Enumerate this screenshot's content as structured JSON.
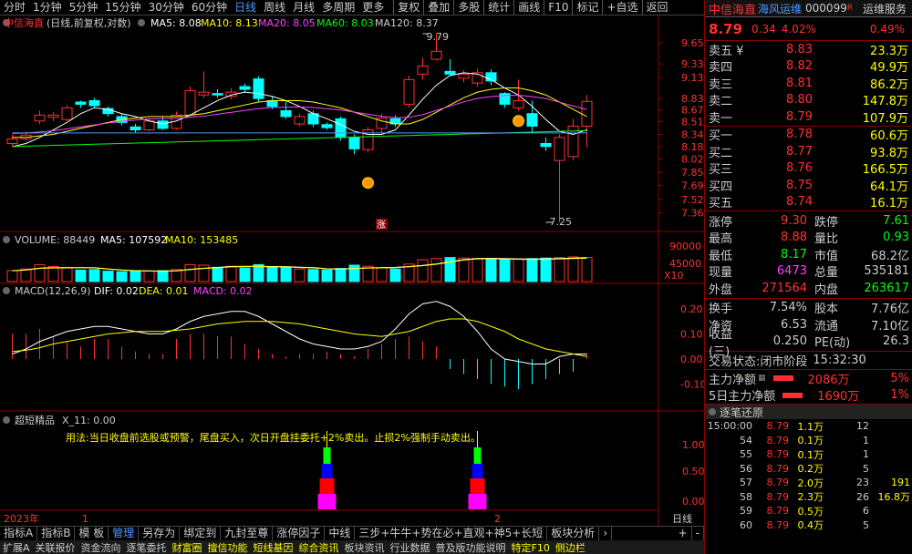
{
  "toolbar": {
    "periods": [
      "分时",
      "1分钟",
      "5分钟",
      "15分钟",
      "30分钟",
      "60分钟",
      "日线",
      "周线",
      "月线",
      "多周期",
      "更多"
    ],
    "active_period": "日线",
    "actions": [
      "复权",
      "叠加",
      "多股",
      "统计",
      "画线",
      "F10",
      "标记",
      "+自选",
      "返回"
    ]
  },
  "chart_header": {
    "name": "中信海直",
    "desc": "(日线,前复权,对数)",
    "ma5": "MA5: 8.08",
    "ma10": "MA10: 8.13",
    "ma20": "MA20: 8.05",
    "ma60": "MA60: 8.03",
    "ma120": "MA120: 8.37"
  },
  "price_axis": [
    "9.65",
    "9.33",
    "9.13",
    "8.83",
    "8.67",
    "8.51",
    "8.34",
    "8.18",
    "8.02",
    "7.85",
    "7.69",
    "7.52",
    "7.36"
  ],
  "annotations": {
    "high": "9.79",
    "low": "7.25",
    "mark": "涨"
  },
  "volume_header": {
    "label": "VOLUME: 88449",
    "ma5": "MA5: 107592",
    "ma10": "MA10: 153485"
  },
  "volume_axis": [
    "90000",
    "45000",
    "X10"
  ],
  "macd_header": {
    "label": "MACD(12,26,9)",
    "dif": "DIF: 0.02",
    "dea": "DEA: 0.01",
    "macd": "MACD: 0.02"
  },
  "macd_axis": [
    "0.20",
    "0.10",
    "0.00",
    "-0.10"
  ],
  "signal_header": {
    "label": "超短精品",
    "x11": "X_11: 0.00",
    "usage": "用法:当日收盘前选股或预警，尾盘买入，次日开盘挂委托+2%卖出。止损2%强制手动卖出。"
  },
  "signal_axis": [
    "1.00",
    "0.50",
    "0.00"
  ],
  "date_axis": {
    "year": "2023年",
    "m1": "1",
    "m2": "2",
    "right_label": "日线",
    "plus": "+",
    "minus": "-"
  },
  "stock": {
    "name": "中信海直",
    "tag": "海风运维",
    "code": "000099",
    "r": "R",
    "service": "运维服务",
    "price": "8.79",
    "change": "0.34",
    "pct": "4.02%",
    "ratio": "0.49%"
  },
  "sells": [
    {
      "label": "卖五 ¥",
      "price": "8.83",
      "vol": "23.3万"
    },
    {
      "label": "卖四",
      "price": "8.82",
      "vol": "49.9万"
    },
    {
      "label": "卖三",
      "price": "8.81",
      "vol": "86.2万"
    },
    {
      "label": "卖二",
      "price": "8.80",
      "vol": "147.8万"
    },
    {
      "label": "卖一",
      "price": "8.79",
      "vol": "107.9万"
    }
  ],
  "buys": [
    {
      "label": "买一",
      "price": "8.78",
      "vol": "60.6万"
    },
    {
      "label": "买二",
      "price": "8.77",
      "vol": "93.8万"
    },
    {
      "label": "买三",
      "price": "8.76",
      "vol": "166.5万"
    },
    {
      "label": "买四",
      "price": "8.75",
      "vol": "64.1万"
    },
    {
      "label": "买五",
      "price": "8.74",
      "vol": "16.1万"
    }
  ],
  "stats1": [
    {
      "a": "涨停",
      "b": "9.30",
      "bc": "red",
      "c": "跌停",
      "d": "7.61",
      "dc": "green"
    },
    {
      "a": "最高",
      "b": "8.88",
      "bc": "red",
      "c": "量比",
      "d": "0.93",
      "dc": "green"
    },
    {
      "a": "最低",
      "b": "8.17",
      "bc": "green",
      "c": "市值",
      "d": "68.2亿",
      "dc": "white"
    },
    {
      "a": "现量",
      "b": "6473",
      "bc": "mag",
      "c": "总量",
      "d": "535181",
      "dc": "white"
    },
    {
      "a": "外盘",
      "b": "271564",
      "bc": "red",
      "c": "内盘",
      "d": "263617",
      "dc": "green"
    }
  ],
  "stats2": [
    {
      "a": "换手",
      "b": "7.54%",
      "bc": "white",
      "c": "股本",
      "d": "7.76亿",
      "dc": "white"
    },
    {
      "a": "净资",
      "b": "6.53",
      "bc": "white",
      "c": "流通",
      "d": "7.10亿",
      "dc": "white"
    },
    {
      "a": "收益(三)",
      "b": "0.250",
      "bc": "white",
      "c": "PE(动)",
      "d": "26.3",
      "dc": "white"
    }
  ],
  "status": {
    "label": "交易状态:",
    "value": "闭市阶段",
    "time": "15:32:30"
  },
  "flows": [
    {
      "label": "主力净额",
      "value": "2086万",
      "pct": "5%"
    },
    {
      "label": "5日主力净额",
      "value": "1690万",
      "pct": "1%"
    }
  ],
  "ticks_head": "逐笔还原",
  "ticks": [
    {
      "t": "15:00:00",
      "p": "8.79",
      "v": "1.1万",
      "n": "12",
      "x": ""
    },
    {
      "t": "54",
      "p": "8.79",
      "v": "0.1万",
      "n": "1",
      "x": ""
    },
    {
      "t": "55",
      "p": "8.79",
      "v": "0.1万",
      "n": "1",
      "x": ""
    },
    {
      "t": "56",
      "p": "8.79",
      "v": "0.2万",
      "n": "5",
      "x": ""
    },
    {
      "t": "57",
      "p": "8.79",
      "v": "2.0万",
      "n": "23",
      "x": "191"
    },
    {
      "t": "58",
      "p": "8.79",
      "v": "2.3万",
      "n": "26",
      "x": "16.8万"
    },
    {
      "t": "59",
      "p": "8.79",
      "v": "0.5万",
      "n": "6",
      "x": ""
    },
    {
      "t": "60",
      "p": "8.79",
      "v": "0.4万",
      "n": "5",
      "x": ""
    }
  ],
  "bottom_tabs": [
    "指标A",
    "指标B",
    "模 板",
    "管理",
    "另存为",
    "绑定到",
    "九封至尊",
    "涨停因子",
    "中线",
    "三步+牛牛+势在必+直观+神5+长短",
    "板块分析"
  ],
  "bottom_active": "管理",
  "status_strip": [
    "扩展A",
    "关联报价",
    "资金流向",
    "逐笔委托",
    "财富圈",
    "擅信功能",
    "短线基因",
    "综合资讯",
    "板块资讯",
    "行业数据",
    "普及版功能说明",
    "特定F10",
    "侧边栏"
  ],
  "colors": {
    "up": "#ff3030",
    "down": "#00ffff",
    "ma5": "#ffffff",
    "ma10": "#ffff00",
    "ma20": "#ff40ff",
    "ma60": "#00ff00",
    "ma120": "#4d9bff"
  },
  "chart_data": {
    "type": "candlestick",
    "candles": [
      {
        "o": 8.22,
        "c": 8.28,
        "h": 8.34,
        "l": 8.18
      },
      {
        "o": 8.28,
        "c": 8.33,
        "h": 8.38,
        "l": 8.26
      },
      {
        "o": 8.52,
        "c": 8.6,
        "h": 8.66,
        "l": 8.48
      },
      {
        "o": 8.57,
        "c": 8.6,
        "h": 8.64,
        "l": 8.52
      },
      {
        "o": 8.54,
        "c": 8.7,
        "h": 8.74,
        "l": 8.52
      },
      {
        "o": 8.78,
        "c": 8.75,
        "h": 8.8,
        "l": 8.7
      },
      {
        "o": 8.8,
        "c": 8.73,
        "h": 8.84,
        "l": 8.7
      },
      {
        "o": 8.69,
        "c": 8.62,
        "h": 8.72,
        "l": 8.58
      },
      {
        "o": 8.58,
        "c": 8.5,
        "h": 8.62,
        "l": 8.46
      },
      {
        "o": 8.44,
        "c": 8.4,
        "h": 8.48,
        "l": 8.36
      },
      {
        "o": 8.4,
        "c": 8.52,
        "h": 8.56,
        "l": 8.38
      },
      {
        "o": 8.52,
        "c": 8.42,
        "h": 8.58,
        "l": 8.4
      },
      {
        "o": 8.42,
        "c": 8.6,
        "h": 8.65,
        "l": 8.4
      },
      {
        "o": 8.6,
        "c": 8.94,
        "h": 9.0,
        "l": 8.58
      },
      {
        "o": 8.88,
        "c": 8.92,
        "h": 9.22,
        "l": 8.84
      },
      {
        "o": 8.9,
        "c": 8.88,
        "h": 8.96,
        "l": 8.84
      },
      {
        "o": 8.86,
        "c": 8.92,
        "h": 8.98,
        "l": 8.82
      },
      {
        "o": 9.0,
        "c": 8.96,
        "h": 9.04,
        "l": 8.92
      },
      {
        "o": 9.11,
        "c": 8.83,
        "h": 9.15,
        "l": 8.78
      },
      {
        "o": 8.8,
        "c": 8.72,
        "h": 8.86,
        "l": 8.68
      },
      {
        "o": 8.66,
        "c": 8.58,
        "h": 8.8,
        "l": 8.55
      },
      {
        "o": 8.48,
        "c": 8.58,
        "h": 8.62,
        "l": 8.45
      },
      {
        "o": 8.62,
        "c": 8.48,
        "h": 8.66,
        "l": 8.44
      },
      {
        "o": 8.47,
        "c": 8.43,
        "h": 8.5,
        "l": 8.4
      },
      {
        "o": 8.55,
        "c": 8.3,
        "h": 8.58,
        "l": 8.26
      },
      {
        "o": 8.3,
        "c": 8.15,
        "h": 8.34,
        "l": 8.08
      },
      {
        "o": 8.14,
        "c": 8.4,
        "h": 8.44,
        "l": 8.1
      },
      {
        "o": 8.42,
        "c": 8.56,
        "h": 8.62,
        "l": 8.36
      },
      {
        "o": 8.55,
        "c": 8.48,
        "h": 8.6,
        "l": 8.44
      },
      {
        "o": 8.75,
        "c": 9.1,
        "h": 9.16,
        "l": 8.7
      },
      {
        "o": 9.18,
        "c": 9.3,
        "h": 9.42,
        "l": 9.1
      },
      {
        "o": 9.4,
        "c": 9.52,
        "h": 9.79,
        "l": 9.38
      },
      {
        "o": 9.22,
        "c": 9.18,
        "h": 9.4,
        "l": 9.15
      },
      {
        "o": 9.12,
        "c": 9.18,
        "h": 9.24,
        "l": 9.06
      },
      {
        "o": 9.05,
        "c": 9.2,
        "h": 9.26,
        "l": 9.0
      },
      {
        "o": 9.2,
        "c": 9.08,
        "h": 9.25,
        "l": 9.02
      },
      {
        "o": 8.9,
        "c": 8.75,
        "h": 8.92,
        "l": 8.7
      },
      {
        "o": 8.7,
        "c": 8.8,
        "h": 9.1,
        "l": 8.66
      },
      {
        "o": 8.62,
        "c": 8.45,
        "h": 8.8,
        "l": 8.36
      },
      {
        "o": 8.22,
        "c": 8.18,
        "h": 8.3,
        "l": 8.12
      },
      {
        "o": 8.0,
        "c": 8.3,
        "h": 8.34,
        "l": 7.25
      },
      {
        "o": 8.05,
        "c": 8.45,
        "h": 8.55,
        "l": 8.0
      },
      {
        "o": 8.45,
        "c": 8.79,
        "h": 8.88,
        "l": 8.17
      }
    ],
    "ma5": [
      8.18,
      8.22,
      8.3,
      8.4,
      8.5,
      8.62,
      8.7,
      8.68,
      8.62,
      8.58,
      8.52,
      8.48,
      8.52,
      8.6,
      8.7,
      8.8,
      8.88,
      8.92,
      8.9,
      8.86,
      8.8,
      8.72,
      8.62,
      8.55,
      8.47,
      8.38,
      8.34,
      8.34,
      8.4,
      8.6,
      8.82,
      9.02,
      9.16,
      9.2,
      9.18,
      9.1,
      8.98,
      8.88,
      8.72,
      8.54,
      8.38,
      8.34,
      8.4
    ],
    "ma10": [
      8.3,
      8.3,
      8.32,
      8.34,
      8.38,
      8.42,
      8.46,
      8.5,
      8.54,
      8.56,
      8.58,
      8.58,
      8.58,
      8.6,
      8.62,
      8.66,
      8.7,
      8.74,
      8.78,
      8.8,
      8.8,
      8.8,
      8.78,
      8.74,
      8.7,
      8.64,
      8.58,
      8.52,
      8.48,
      8.48,
      8.54,
      8.64,
      8.74,
      8.84,
      8.92,
      8.96,
      8.98,
      8.98,
      8.94,
      8.88,
      8.78,
      8.68,
      8.58
    ],
    "volume": [
      40000,
      46000,
      62000,
      55000,
      52000,
      42000,
      44000,
      38000,
      36000,
      40000,
      38000,
      40000,
      44000,
      62000,
      60000,
      52000,
      56000,
      50000,
      62000,
      54000,
      50000,
      46000,
      44000,
      42000,
      48000,
      60000,
      56000,
      50000,
      46000,
      64000,
      80000,
      84000,
      88000,
      86000,
      84000,
      82000,
      80000,
      82000,
      84000,
      86000,
      88000,
      90000,
      88449
    ],
    "macd_dif": [
      0.02,
      0.04,
      0.07,
      0.09,
      0.11,
      0.12,
      0.13,
      0.13,
      0.12,
      0.11,
      0.1,
      0.1,
      0.12,
      0.15,
      0.17,
      0.18,
      0.19,
      0.19,
      0.17,
      0.14,
      0.11,
      0.08,
      0.06,
      0.05,
      0.04,
      0.04,
      0.05,
      0.07,
      0.12,
      0.18,
      0.22,
      0.23,
      0.21,
      0.17,
      0.11,
      0.04,
      0.0,
      -0.01,
      -0.02,
      -0.02,
      0.01,
      0.02,
      0.02
    ],
    "macd_dea": [
      0.03,
      0.035,
      0.045,
      0.06,
      0.07,
      0.08,
      0.09,
      0.1,
      0.105,
      0.11,
      0.11,
      0.11,
      0.115,
      0.12,
      0.13,
      0.14,
      0.145,
      0.15,
      0.15,
      0.15,
      0.145,
      0.14,
      0.13,
      0.12,
      0.11,
      0.1,
      0.095,
      0.09,
      0.1,
      0.11,
      0.13,
      0.15,
      0.16,
      0.16,
      0.15,
      0.13,
      0.11,
      0.08,
      0.06,
      0.04,
      0.03,
      0.02,
      0.01
    ],
    "macd_hist": [
      0.1,
      0.1,
      0.12,
      0.09,
      0.07,
      0.05,
      0.08,
      0.08,
      0.05,
      0.03,
      0.02,
      0.02,
      0.08,
      0.1,
      0.1,
      0.09,
      0.09,
      0.06,
      0.04,
      0.02,
      0.01,
      0.02,
      0.02,
      0.03,
      0.02,
      0.01,
      0.04,
      0.06,
      0.08,
      0.09,
      0.07,
      0.05,
      -0.04,
      -0.06,
      -0.08,
      -0.1,
      -0.11,
      -0.12,
      -0.1,
      -0.08,
      -0.06,
      -0.05,
      0.02
    ],
    "signals": [
      {
        "index": 23
      },
      {
        "index": 34
      }
    ],
    "price_range": [
      7.25,
      9.79
    ]
  }
}
